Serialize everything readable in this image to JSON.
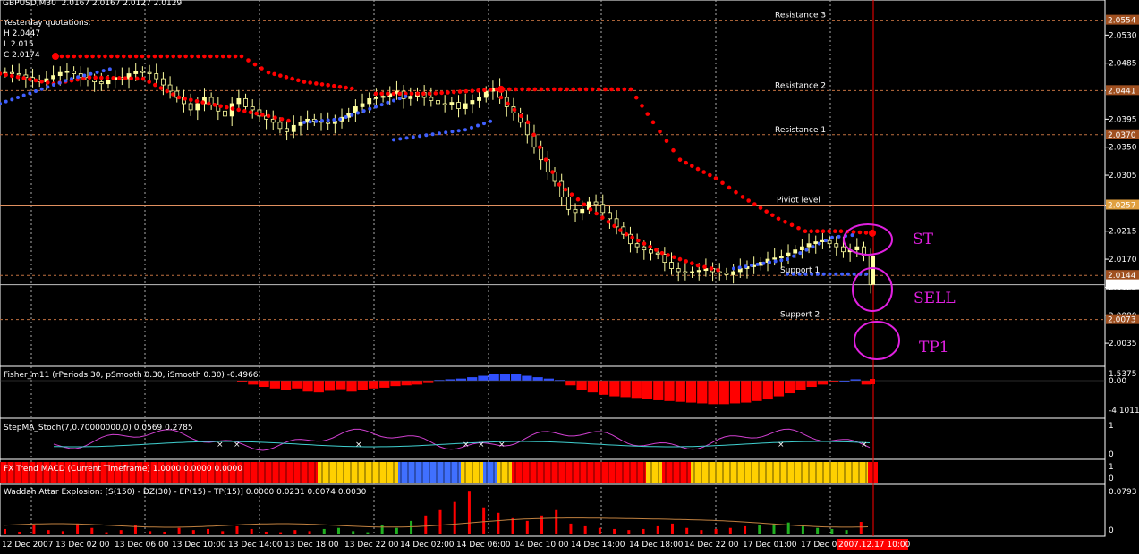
{
  "header": {
    "symbol": "GBPUSD,M30",
    "ohlc": "2.0167 2.0167 2.0127 2.0129",
    "yesterday_title": "Yesterday quotations:",
    "yesterday_h": "H 2.0447",
    "yesterday_l": "L 2.015",
    "yesterday_c": "C 2.0174"
  },
  "levels": [
    {
      "name": "Resistance 3",
      "price": 2.0554,
      "label": "2.0554",
      "color": "#c08040"
    },
    {
      "name": "Resistance 2",
      "price": 2.0441,
      "label": "2.0441",
      "color": "#c08040"
    },
    {
      "name": "Resistance 1",
      "price": 2.037,
      "label": "2.0370",
      "color": "#c08040"
    },
    {
      "name": "Piviot level",
      "price": 2.0257,
      "label": "2.0257",
      "color": "#e0a040"
    },
    {
      "name": "Support 1",
      "price": 2.0144,
      "label": "2.0144",
      "color": "#c08040"
    },
    {
      "name": "Support 2",
      "price": 2.0073,
      "label": "2.0073",
      "color": "#c08040"
    }
  ],
  "current_price": {
    "price": 2.0129,
    "label": "2.0129"
  },
  "annotations": {
    "st": "ST",
    "sell": "SELL",
    "tp1": "TP1"
  },
  "colors": {
    "up_dots": "#ff0000",
    "down_dots": "#4060ff",
    "bull": "#ffff80",
    "bear": "#000000",
    "annotation": "#e020e0"
  },
  "indicators": {
    "fisher": {
      "label": "Fisher_m11  (rPeriods 30, pSmooth 0.30, iSmooth 0.30)  -0.4966",
      "ticks": [
        "1.5375",
        "0.00",
        "-4.1011"
      ]
    },
    "stoch": {
      "label": "StepMA_Stoch(7,0.70000000,0) 0.0569 0.2785",
      "ticks": [
        "1",
        "0"
      ]
    },
    "macd": {
      "label": "FX Trend MACD (Current Timeframe) 1.0000 0.0000 0.0000",
      "ticks": [
        "1",
        "0"
      ]
    },
    "waddah": {
      "label": "Waddah Attar Explosion: [S(150) - DZ(30) - EP(15) - TP(15)] 0.0000 0.0231 0.0074 0.0030",
      "ticks": [
        "0.0793",
        "0"
      ]
    }
  },
  "time_axis": {
    "labels": [
      "12 Dec 2007",
      "13 Dec 02:00",
      "13 Dec 06:00",
      "13 Dec 10:00",
      "13 Dec 14:00",
      "13 Dec 18:00",
      "13 Dec 22:00",
      "14 Dec 02:00",
      "14 Dec 06:00",
      "14 Dec 10:00",
      "14 Dec 14:00",
      "14 Dec 18:00",
      "14 Dec 22:00",
      "17 Dec 01:00",
      "17 Dec 05"
    ],
    "current": "2007.12.17 10:00"
  },
  "chart_data": {
    "type": "candlestick",
    "title": "GBPUSD,M30",
    "ylim": [
      2.0005,
      2.0575
    ],
    "y_ticks": [
      "2.0530",
      "2.0485",
      "2.0441",
      "2.0395",
      "2.0350",
      "2.0305",
      "2.0257",
      "2.0215",
      "2.0170",
      "2.0125",
      "2.0080",
      "2.0035"
    ],
    "y_tick_values": [
      2.053,
      2.0485,
      2.0441,
      2.0395,
      2.035,
      2.0305,
      2.0257,
      2.0215,
      2.017,
      2.0125,
      2.008,
      2.0035
    ],
    "close_series": [
      2.047,
      2.0468,
      2.0466,
      2.0462,
      2.0458,
      2.0455,
      2.046,
      2.0465,
      2.047,
      2.0472,
      2.0468,
      2.0462,
      2.0458,
      2.0455,
      2.0452,
      2.0458,
      2.0462,
      2.046,
      2.0468,
      2.0472,
      2.047,
      2.0468,
      2.046,
      2.045,
      2.044,
      2.043,
      2.042,
      2.041,
      2.042,
      2.043,
      2.0418,
      2.0408,
      2.04,
      2.042,
      2.0428,
      2.0415,
      2.041,
      2.04,
      2.0395,
      2.039,
      2.038,
      2.0375,
      2.0385,
      2.039,
      2.0395,
      2.0392,
      2.039,
      2.0388,
      2.0392,
      2.0398,
      2.0405,
      2.0415,
      2.042,
      2.0428,
      2.043,
      2.0432,
      2.0436,
      2.044,
      2.0428,
      2.0432,
      2.0438,
      2.043,
      2.0425,
      2.042,
      2.0418,
      2.0422,
      2.0412,
      2.042,
      2.0425,
      2.043,
      2.044,
      2.0445,
      2.043,
      2.0415,
      2.0405,
      2.039,
      2.037,
      2.035,
      2.033,
      2.031,
      2.0295,
      2.027,
      2.025,
      2.0245,
      2.025,
      2.0262,
      2.0258,
      2.0245,
      2.0235,
      2.0222,
      2.021,
      2.0195,
      2.019,
      2.0185,
      2.018,
      2.0178,
      2.0165,
      2.0155,
      2.015,
      2.0148,
      2.015,
      2.0152,
      2.0155,
      2.015,
      2.0148,
      2.0145,
      2.015,
      2.0155,
      2.0158,
      2.016,
      2.0165,
      2.017,
      2.0172,
      2.0175,
      2.018,
      2.0185,
      2.019,
      2.0195,
      2.0198,
      2.02,
      2.0195,
      2.019,
      2.0182,
      2.0185,
      2.019,
      2.0175,
      2.0129
    ],
    "up_stop_points": [
      [
        62,
        2.0496
      ],
      [
        270,
        2.0496
      ],
      [
        300,
        2.047
      ],
      [
        340,
        2.0455
      ],
      [
        400,
        2.0443
      ],
      [
        420,
        2.0436
      ],
      [
        480,
        2.0436
      ],
      [
        555,
        2.0443
      ],
      [
        705,
        2.0443
      ],
      [
        730,
        2.039
      ],
      [
        760,
        2.033
      ],
      [
        800,
        2.03
      ],
      [
        830,
        2.027
      ],
      [
        870,
        2.0235
      ],
      [
        900,
        2.0215
      ],
      [
        940,
        2.0215
      ],
      [
        975,
        2.0212
      ]
    ],
    "down_stop_points": [
      [
        0,
        2.042
      ],
      [
        80,
        2.046
      ],
      [
        130,
        2.048
      ],
      [
        440,
        2.0362
      ],
      [
        520,
        2.038
      ],
      [
        555,
        2.04
      ],
      [
        880,
        2.0144
      ],
      [
        975,
        2.0144
      ]
    ],
    "fisher_values": [
      -0.2,
      -0.5,
      -0.8,
      -1.0,
      -1.2,
      -1.0,
      -1.4,
      -1.5,
      -1.3,
      -1.1,
      -1.4,
      -1.2,
      -1.0,
      -0.9,
      -0.7,
      -0.6,
      -0.5,
      -0.3,
      0.1,
      0.2,
      0.3,
      0.5,
      0.7,
      0.9,
      1.0,
      0.9,
      0.7,
      0.5,
      0.3,
      0.1,
      -0.6,
      -1.2,
      -1.5,
      -1.8,
      -2.0,
      -2.1,
      -2.2,
      -2.3,
      -2.5,
      -2.6,
      -2.7,
      -2.8,
      -2.9,
      -3.0,
      -3.0,
      -2.9,
      -2.8,
      -2.6,
      -2.4,
      -2.0,
      -1.6,
      -1.2,
      -0.8,
      -0.5,
      -0.2,
      0.0,
      0.2,
      -0.4966
    ],
    "waddah_values": [
      0.01,
      0.005,
      0.018,
      0.008,
      0.006,
      0.02,
      0.012,
      0.004,
      0.008,
      0.018,
      0.006,
      0.005,
      0.012,
      0.008,
      0.01,
      0.006,
      0.015,
      0.01,
      0.005,
      0.004,
      0.008,
      0.006,
      0.01,
      0.012,
      0.006,
      0.004,
      0.018,
      0.012,
      0.025,
      0.035,
      0.045,
      0.06,
      0.079,
      0.05,
      0.04,
      0.03,
      0.025,
      0.035,
      0.045,
      0.02,
      0.015,
      0.012,
      0.01,
      0.008,
      0.01,
      0.015,
      0.02,
      0.012,
      0.008,
      0.01,
      0.012,
      0.015,
      0.018,
      0.02,
      0.022,
      0.015,
      0.012,
      0.01,
      0.008,
      0.0231
    ]
  }
}
